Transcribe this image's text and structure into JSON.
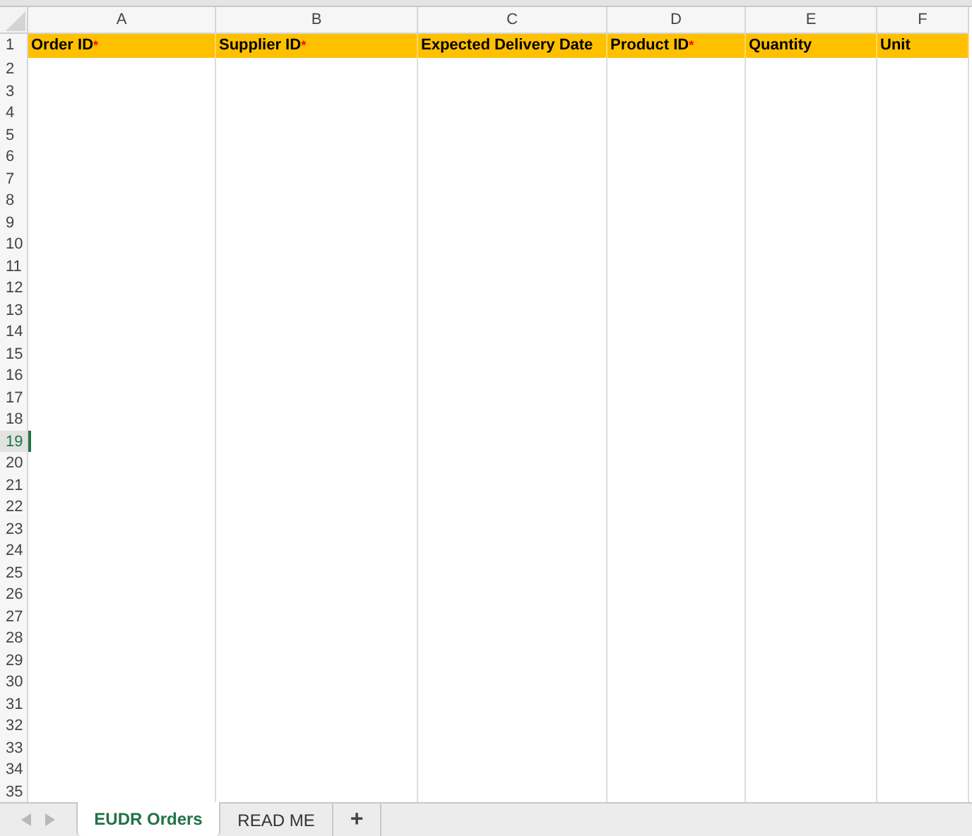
{
  "columns": [
    {
      "letter": "A",
      "label": "Order ID",
      "mark": "*"
    },
    {
      "letter": "B",
      "label": "Supplier ID",
      "mark": "*"
    },
    {
      "letter": "C",
      "label": "Expected Delivery Date"
    },
    {
      "letter": "D",
      "label": "Product ID",
      "mark": "*"
    },
    {
      "letter": "E",
      "label": "Quantity"
    },
    {
      "letter": "F",
      "label": "Unit"
    }
  ],
  "rows": [
    {
      "number": "2",
      "selected": false
    },
    {
      "number": "3",
      "selected": false
    },
    {
      "number": "4",
      "selected": false
    },
    {
      "number": "5",
      "selected": false
    },
    {
      "number": "6",
      "selected": false
    },
    {
      "number": "7",
      "selected": false
    },
    {
      "number": "8",
      "selected": false
    },
    {
      "number": "9",
      "selected": false
    },
    {
      "number": "10",
      "selected": false
    },
    {
      "number": "11",
      "selected": false
    },
    {
      "number": "12",
      "selected": false
    },
    {
      "number": "13",
      "selected": false
    },
    {
      "number": "14",
      "selected": false
    },
    {
      "number": "15",
      "selected": false
    },
    {
      "number": "16",
      "selected": false
    },
    {
      "number": "17",
      "selected": false
    },
    {
      "number": "18",
      "selected": false
    },
    {
      "number": "19",
      "selected": true
    },
    {
      "number": "20",
      "selected": false
    },
    {
      "number": "21",
      "selected": false
    },
    {
      "number": "22",
      "selected": false
    },
    {
      "number": "23",
      "selected": false
    },
    {
      "number": "24",
      "selected": false
    },
    {
      "number": "25",
      "selected": false
    },
    {
      "number": "26",
      "selected": false
    },
    {
      "number": "27",
      "selected": false
    },
    {
      "number": "28",
      "selected": false
    },
    {
      "number": "29",
      "selected": false
    },
    {
      "number": "30",
      "selected": false
    },
    {
      "number": "31",
      "selected": false
    },
    {
      "number": "32",
      "selected": false
    },
    {
      "number": "33",
      "selected": false
    },
    {
      "number": "34",
      "selected": false
    },
    {
      "number": "35",
      "selected": false
    }
  ],
  "header_row_number": "1",
  "sheet_tabs": [
    {
      "label": "EUDR Orders",
      "selected": true
    },
    {
      "label": "READ ME",
      "selected": false
    }
  ],
  "add_sheet": "+"
}
